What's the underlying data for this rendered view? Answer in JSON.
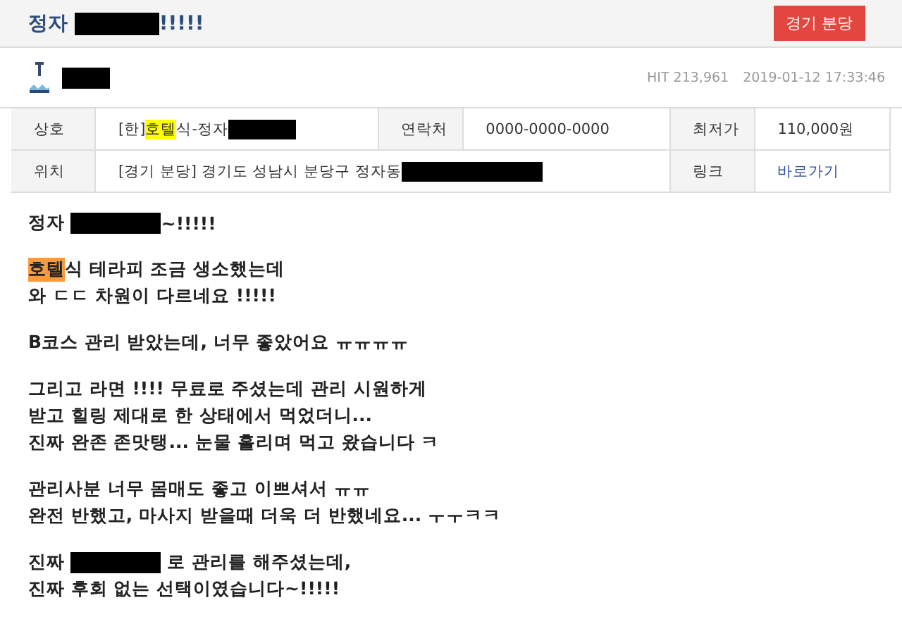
{
  "header": {
    "title": [
      {
        "kind": "text",
        "text": "정자 "
      },
      {
        "kind": "redacted"
      },
      {
        "kind": "text",
        "text": "!!!!!"
      }
    ],
    "region_button": "경기 분당"
  },
  "author": {
    "name_redacted": true,
    "hits": "HIT 213,961",
    "date": "2019-01-12 17:33:46"
  },
  "info_table": {
    "rows": [
      {
        "cells": [
          {
            "kind": "label",
            "parts": [
              {
                "kind": "text",
                "text": "상호"
              }
            ]
          },
          {
            "kind": "value",
            "parts": [
              {
                "kind": "text",
                "text": "[한]"
              },
              {
                "kind": "highlight",
                "text": "호텔"
              },
              {
                "kind": "text",
                "text": "식-정자"
              },
              {
                "kind": "redacted"
              }
            ]
          },
          {
            "kind": "label",
            "parts": [
              {
                "kind": "text",
                "text": "연락처"
              }
            ]
          },
          {
            "kind": "value",
            "parts": [
              {
                "kind": "text",
                "text": "0000-0000-0000"
              }
            ]
          },
          {
            "kind": "label",
            "parts": [
              {
                "kind": "text",
                "text": "최저가"
              }
            ]
          },
          {
            "kind": "value",
            "parts": [
              {
                "kind": "text",
                "text": "110,000원"
              }
            ]
          }
        ]
      },
      {
        "cells": [
          {
            "kind": "label",
            "parts": [
              {
                "kind": "text",
                "text": "위치"
              }
            ]
          },
          {
            "kind": "value",
            "colspan": 3,
            "parts": [
              {
                "kind": "text",
                "text": "[경기 분당] 경기도 성남시 분당구 정자동"
              },
              {
                "kind": "redacted"
              }
            ]
          },
          {
            "kind": "label",
            "parts": [
              {
                "kind": "text",
                "text": "링크"
              }
            ]
          },
          {
            "kind": "value",
            "parts": [
              {
                "kind": "link",
                "text": "바로가기"
              }
            ]
          }
        ]
      }
    ]
  },
  "body": {
    "paragraphs": [
      [
        [
          {
            "kind": "text",
            "text": "정자 "
          },
          {
            "kind": "redacted"
          },
          {
            "kind": "text",
            "text": "~!!!!!"
          }
        ]
      ],
      [
        [
          {
            "kind": "mark",
            "text": "호텔"
          },
          {
            "kind": "text",
            "text": "식 테라피 조금 생소했는데"
          }
        ],
        [
          {
            "kind": "text",
            "text": "와 ㄷㄷ 차원이 다르네요 !!!!!"
          }
        ]
      ],
      [
        [
          {
            "kind": "text",
            "text": "B코스 관리 받았는데, 너무 좋았어요 ㅠㅠㅠㅠ"
          }
        ]
      ],
      [
        [
          {
            "kind": "text",
            "text": "그리고 라면 !!!! 무료로 주셨는데 관리 시원하게"
          }
        ],
        [
          {
            "kind": "text",
            "text": "받고 힐링 제대로 한 상태에서 먹었더니..."
          }
        ],
        [
          {
            "kind": "text",
            "text": "진짜 완존 존맛탱... 눈물 흘리며 먹고 왔습니다 ㅋ"
          }
        ]
      ],
      [
        [
          {
            "kind": "text",
            "text": "관리사분 너무 몸매도 좋고 이쁘셔서 ㅠㅠ"
          }
        ],
        [
          {
            "kind": "text",
            "text": "완전 반했고, 마사지 받을때 더욱 더 반했네요... ㅜㅜㅋㅋ"
          }
        ]
      ],
      [
        [
          {
            "kind": "text",
            "text": "진짜 "
          },
          {
            "kind": "redacted"
          },
          {
            "kind": "text",
            "text": " 로 관리를 해주셨는데,"
          }
        ],
        [
          {
            "kind": "text",
            "text": "진짜 후회 없는 선택이였습니다~!!!!!"
          }
        ]
      ]
    ]
  }
}
